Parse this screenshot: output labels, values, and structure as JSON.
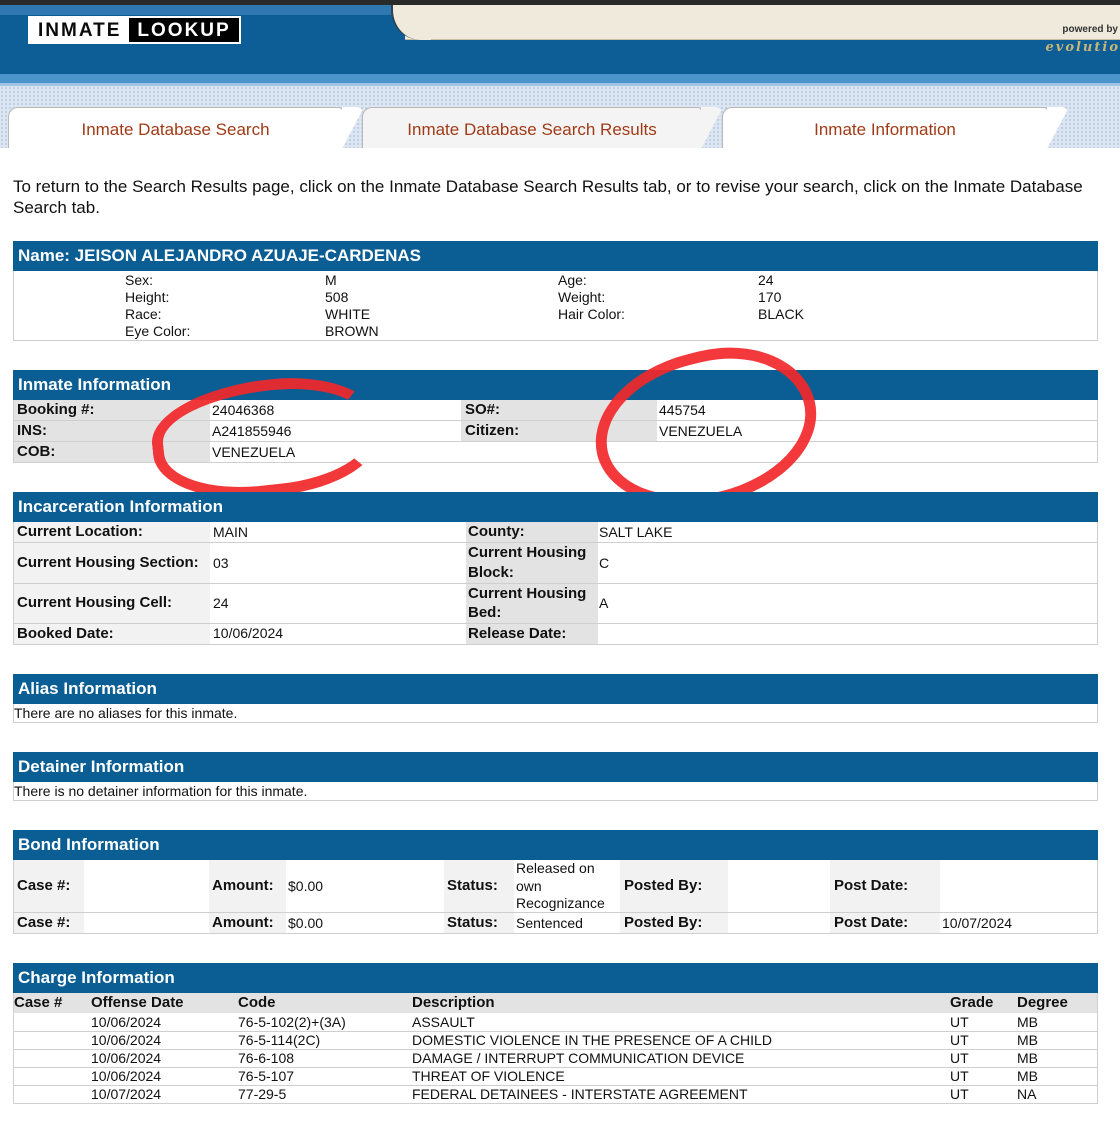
{
  "header": {
    "logo_word1": "INMATE",
    "logo_word2": "LOOKUP",
    "powered_by": "powered by",
    "brand": "evolutio"
  },
  "tabs": [
    {
      "label": "Inmate Database Search"
    },
    {
      "label": "Inmate Database Search Results"
    },
    {
      "label": "Inmate Information"
    }
  ],
  "intro": "To return to the Search Results page, click on the Inmate Database Search Results tab, or to revise your search, click on the Inmate Database Search tab.",
  "name_section": {
    "title": "Name: JEISON ALEJANDRO AZUAJE-CARDENAS",
    "left": [
      {
        "label": "Sex:",
        "value": "M"
      },
      {
        "label": "Height:",
        "value": "508"
      },
      {
        "label": "Race:",
        "value": "WHITE"
      },
      {
        "label": "Eye Color:",
        "value": "BROWN"
      }
    ],
    "right": [
      {
        "label": "Age:",
        "value": "24"
      },
      {
        "label": "Weight:",
        "value": "170"
      },
      {
        "label": "Hair Color:",
        "value": "BLACK"
      }
    ]
  },
  "inmate_info": {
    "title": "Inmate Information",
    "booking_label": "Booking #:",
    "booking": "24046368",
    "ins_label": "INS:",
    "ins": "A241855946",
    "cob_label": "COB:",
    "cob": "VENEZUELA",
    "so_label": "SO#:",
    "so": "445754",
    "citizen_label": "Citizen:",
    "citizen": "VENEZUELA"
  },
  "incarceration": {
    "title": "Incarceration Information",
    "location_label": "Current Location:",
    "location": "MAIN",
    "section_label": "Current Housing Section:",
    "section": "03",
    "cell_label": "Current Housing Cell:",
    "cell": "24",
    "booked_label": "Booked Date:",
    "booked": "10/06/2024",
    "county_label": "County:",
    "county": "SALT LAKE",
    "block_label_1": "Current Housing",
    "block_label_2": "Block:",
    "block": "C",
    "bed_label_1": "Current Housing",
    "bed_label_2": "Bed:",
    "bed": "A",
    "release_label": "Release Date:",
    "release": ""
  },
  "alias": {
    "title": "Alias Information",
    "message": "There are no aliases for this inmate."
  },
  "detainer": {
    "title": "Detainer Information",
    "message": "There is no detainer information for this inmate."
  },
  "bond": {
    "title": "Bond Information",
    "labels": {
      "case": "Case #:",
      "amount": "Amount:",
      "status": "Status:",
      "posted": "Posted By:",
      "post_date": "Post Date:"
    },
    "rows": [
      {
        "case": "",
        "amount": "$0.00",
        "status_1": "Released on",
        "status_2": "own",
        "status_3": "Recognizance",
        "posted": "",
        "post_date": ""
      },
      {
        "case": "",
        "amount": "$0.00",
        "status_1": "Sentenced",
        "posted": "",
        "post_date": "10/07/2024"
      }
    ]
  },
  "charges": {
    "title": "Charge Information",
    "headers": {
      "case": "Case #",
      "date": "Offense Date",
      "code": "Code",
      "desc": "Description",
      "grade": "Grade",
      "degree": "Degree"
    },
    "rows": [
      {
        "case": "",
        "date": "10/06/2024",
        "code": "76-5-102(2)+(3A)",
        "desc": "ASSAULT",
        "grade": "UT",
        "degree": "MB"
      },
      {
        "case": "",
        "date": "10/06/2024",
        "code": "76-5-114(2C)",
        "desc": "DOMESTIC VIOLENCE IN THE PRESENCE OF A CHILD",
        "grade": "UT",
        "degree": "MB"
      },
      {
        "case": "",
        "date": "10/06/2024",
        "code": "76-6-108",
        "desc": "DAMAGE / INTERRUPT COMMUNICATION DEVICE",
        "grade": "UT",
        "degree": "MB"
      },
      {
        "case": "",
        "date": "10/06/2024",
        "code": "76-5-107",
        "desc": "THREAT OF VIOLENCE",
        "grade": "UT",
        "degree": "MB"
      },
      {
        "case": "",
        "date": "10/07/2024",
        "code": "77-29-5",
        "desc": "FEDERAL DETAINEES - INTERSTATE AGREEMENT",
        "grade": "UT",
        "degree": "NA"
      }
    ]
  },
  "colors": {
    "header_blue": "#0b5e93",
    "tab_text": "#a13a16",
    "annotation_red": "#f2282a"
  }
}
